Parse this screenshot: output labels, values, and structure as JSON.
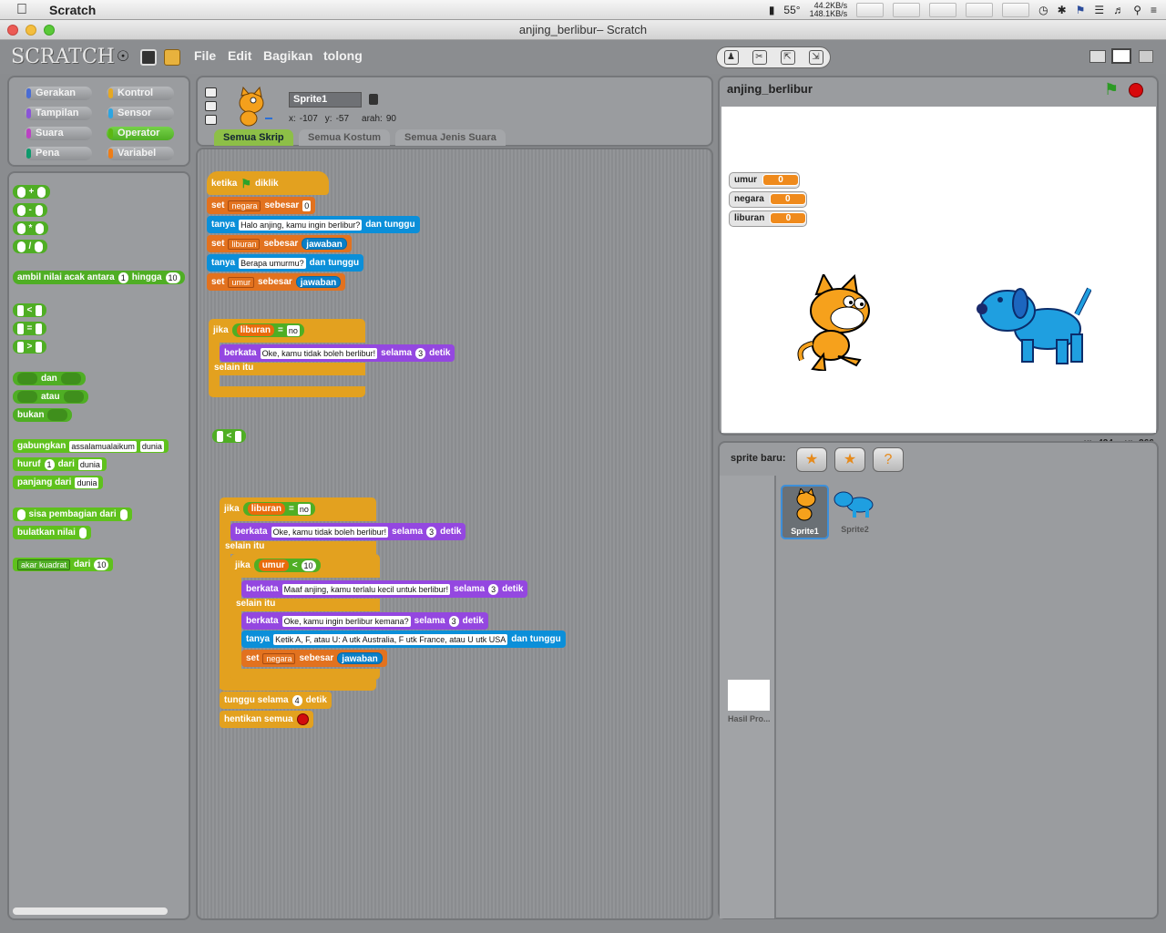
{
  "menubar": {
    "app_name": "Scratch",
    "temp": "55°",
    "net_up": "44.2KB/s",
    "net_down": "148.1KB/s",
    "icons": [
      "apple-icon",
      "bookmark-icon",
      "clock-icon",
      "bluetooth-icon",
      "flag-icon",
      "wifi-icon",
      "volume-icon",
      "search-icon",
      "list-icon"
    ]
  },
  "window": {
    "title": "anjing_berlibur– Scratch"
  },
  "toolbar": {
    "logo": "SCRATCH",
    "menus": {
      "file": "File",
      "edit": "Edit",
      "share": "Bagikan",
      "help": "tolong"
    }
  },
  "categories": {
    "motion": "Gerakan",
    "control": "Kontrol",
    "looks": "Tampilan",
    "sensing": "Sensor",
    "sound": "Suara",
    "operators": "Operator",
    "pen": "Pena",
    "variables": "Variabel",
    "colors": {
      "motion": "#4a6cd4",
      "control": "#e6a822",
      "looks": "#8a55d7",
      "sensing": "#2ca5e2",
      "sound": "#bb42c3",
      "operators": "#5cb712",
      "pen": "#0e9a6c",
      "variables": "#ee7d16"
    }
  },
  "palette": {
    "plus": "+",
    "minus": "-",
    "times": "*",
    "divide": "/",
    "random_a": "ambil nilai acak antara",
    "random_from": "1",
    "random_b": "hingga",
    "random_to": "10",
    "lt": "<",
    "eq": "=",
    "gt": ">",
    "and": "dan",
    "or": "atau",
    "not": "bukan",
    "join": "gabungkan",
    "join_a": "assalamualaikum",
    "join_b": "dunia",
    "letter": "huruf",
    "letter_n": "1",
    "letter_of": "dari",
    "letter_word": "dunia",
    "length": "panjang dari",
    "length_word": "dunia",
    "mod": "sisa pembagian dari",
    "round": "bulatkan nilai",
    "sqrt": "akar kuadrat",
    "sqrt_of": "dari",
    "sqrt_n": "10"
  },
  "sprite_info": {
    "name": "Sprite1",
    "x_label": "x:",
    "x": "-107",
    "y_label": "y:",
    "y": "-57",
    "dir_label": "arah:",
    "dir": "90"
  },
  "tabs": {
    "scripts": "Semua Skrip",
    "costumes": "Semua Kostum",
    "sounds": "Semua Jenis Suara"
  },
  "script": {
    "when": "ketika",
    "clicked": "diklik",
    "set": "set",
    "to": "sebesar",
    "var_negara": "negara",
    "var_liburan": "liburan",
    "var_umur": "umur",
    "zero": "0",
    "ask": "tanya",
    "and_wait": "dan tunggu",
    "q1": "Halo anjing, kamu ingin berlibur?",
    "q2": "Berapa umurmu?",
    "answer": "jawaban",
    "if": "jika",
    "else": "selain itu",
    "no": "no",
    "eq": "=",
    "lt": "<",
    "say": "berkata",
    "for": "selama",
    "secs": "detik",
    "three": "3",
    "s1": "Oke, kamu tidak boleh berlibur!",
    "s2": "Maaf anjing, kamu terlalu kecil untuk berlibur!",
    "s3": "Oke, kamu ingin berlibur kemana?",
    "q3": "Ketik A, F, atau U:  A utk Australia, F utk France, atau U utk USA",
    "ten": "10",
    "wait": "tunggu selama",
    "wait_n": "4",
    "stop_all": "hentikan semua"
  },
  "stage": {
    "title": "anjing_berlibur",
    "monitors": [
      {
        "name": "umur",
        "value": "0"
      },
      {
        "name": "negara",
        "value": "0"
      },
      {
        "name": "liburan",
        "value": "0"
      }
    ],
    "coord_x_label": "x:",
    "coord_x": "-424",
    "coord_y_label": "y:",
    "coord_y": "-266"
  },
  "sprites": {
    "new_sprite": "sprite baru:",
    "list": [
      {
        "name": "Sprite1"
      },
      {
        "name": "Sprite2"
      }
    ],
    "stage_label": "Hasil Pro..."
  }
}
